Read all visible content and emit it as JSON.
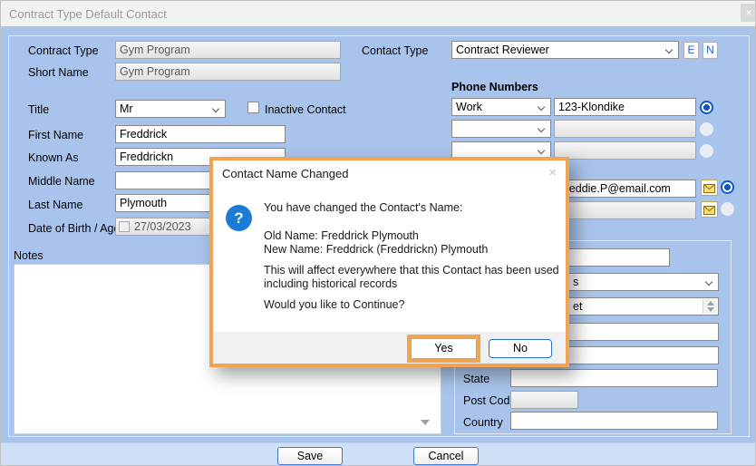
{
  "window": {
    "title": "Contract Type Default Contact",
    "close_glyph": "×"
  },
  "left": {
    "contract_type_label": "Contract Type",
    "contract_type_value": "Gym Program",
    "short_name_label": "Short Name",
    "short_name_value": "Gym Program",
    "title_label": "Title",
    "title_value": "Mr",
    "inactive_label": "Inactive Contact",
    "first_name_label": "First Name",
    "first_name_value": "Freddrick",
    "known_as_label": "Known As",
    "known_as_value": "Freddrickn",
    "middle_name_label": "Middle Name",
    "middle_name_value": "",
    "last_name_label": "Last Name",
    "last_name_value": "Plymouth",
    "dob_label": "Date of Birth / Age",
    "dob_value": "27/03/2023",
    "notes_label": "Notes",
    "notes_value": ""
  },
  "right": {
    "contact_type_label": "Contact Type",
    "contact_type_value": "Contract Reviewer",
    "e_button": "E",
    "n_button": "N",
    "phone_heading": "Phone Numbers",
    "phone_rows": [
      {
        "type": "Work",
        "number": "123-Klondike",
        "selected": true
      },
      {
        "type": "",
        "number": "",
        "selected": false
      },
      {
        "type": "",
        "number": "",
        "selected": false
      }
    ],
    "email_rows": [
      {
        "address": "Freddie.P@email.com",
        "selected": true
      },
      {
        "address": "",
        "selected": false
      }
    ],
    "address": {
      "line1_value": "",
      "dropdown_visible_text": "s",
      "street_visible_text": "et",
      "line4_value": "",
      "line5_value": "",
      "state_label": "State",
      "state_value": "",
      "post_code_label": "Post Code",
      "post_code_value": "",
      "country_label": "Country",
      "country_value": ""
    }
  },
  "footer": {
    "save": "Save",
    "cancel": "Cancel"
  },
  "dialog": {
    "title": "Contact Name Changed",
    "close_glyph": "×",
    "icon_glyph": "?",
    "line1": "You have changed the Contact's Name:",
    "line2": "Old Name: Freddrick Plymouth",
    "line3": "New Name: Freddrick (Freddrickn) Plymouth",
    "line4": "This will affect everywhere that this Contact has been used including historical records",
    "line5": "Would you like to Continue?",
    "yes": "Yes",
    "no": "No"
  },
  "colors": {
    "window_bg": "#a8c4ec",
    "titlebar_bg": "#f2f2f2",
    "footer_bg": "#cfe0f6",
    "highlight_orange": "#f2a351",
    "radio_selected_blue": "#0f57c8",
    "dialog_icon_blue": "#1b7cd6",
    "button_border_blue": "#2e6fd4"
  }
}
